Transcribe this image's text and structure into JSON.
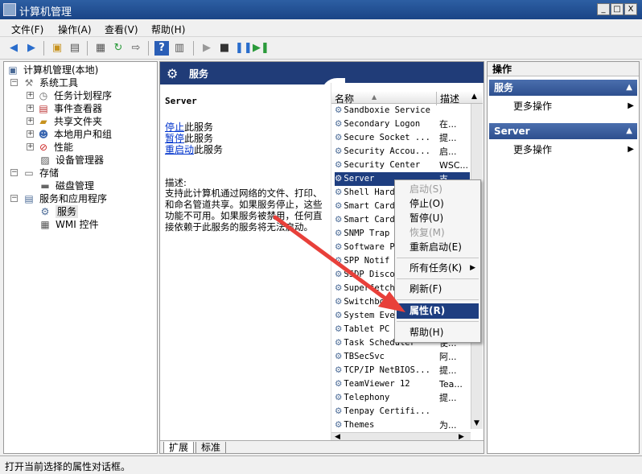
{
  "window": {
    "title": "计算机管理",
    "min": "_",
    "max": "□",
    "close": "X"
  },
  "menu": [
    "文件(F)",
    "操作(A)",
    "查看(V)",
    "帮助(H)"
  ],
  "tree": {
    "root": "计算机管理(本地)",
    "system_tools": "系统工具",
    "task_scheduler": "任务计划程序",
    "event_viewer": "事件查看器",
    "shared_folders": "共享文件夹",
    "local_users": "本地用户和组",
    "performance": "性能",
    "device_manager": "设备管理器",
    "storage": "存储",
    "disk_mgmt": "磁盘管理",
    "services_apps": "服务和应用程序",
    "services": "服务",
    "wmi": "WMI 控件"
  },
  "center": {
    "header": "服务",
    "service_name": "Server",
    "stop_link": "停止",
    "stop_suffix": "此服务",
    "pause_link": "暂停",
    "pause_suffix": "此服务",
    "restart_link": "重启动",
    "restart_suffix": "此服务",
    "desc_label": "描述:",
    "desc_text": "支持此计算机通过网络的文件、打印、和命名管道共享。如果服务停止，这些功能不可用。如果服务被禁用，任何直接依赖于此服务的服务将无法启动。",
    "col_name": "名称",
    "col_desc": "描述",
    "tab_extended": "扩展",
    "tab_standard": "标准"
  },
  "services": [
    {
      "name": "Sandboxie Service",
      "desc": ""
    },
    {
      "name": "Secondary Logon",
      "desc": "在..."
    },
    {
      "name": "Secure Socket ...",
      "desc": "提..."
    },
    {
      "name": "Security Accou...",
      "desc": "启..."
    },
    {
      "name": "Security Center",
      "desc": "WSC..."
    },
    {
      "name": "Server",
      "desc": "支..."
    },
    {
      "name": "Shell Hard",
      "desc": ""
    },
    {
      "name": "Smart Card",
      "desc": ""
    },
    {
      "name": "Smart Card",
      "desc": ""
    },
    {
      "name": "SNMP Trap",
      "desc": ""
    },
    {
      "name": "Software P",
      "desc": ""
    },
    {
      "name": "SPP Notif",
      "desc": ""
    },
    {
      "name": "SSDP Disco",
      "desc": ""
    },
    {
      "name": "Superfetch",
      "desc": ""
    },
    {
      "name": "Switchboard",
      "desc": ""
    },
    {
      "name": "System Eve",
      "desc": ""
    },
    {
      "name": "Tablet PC",
      "desc": ""
    },
    {
      "name": "Task Scheduler",
      "desc": "使..."
    },
    {
      "name": "TBSecSvc",
      "desc": "阿..."
    },
    {
      "name": "TCP/IP NetBIOS...",
      "desc": "提..."
    },
    {
      "name": "TeamViewer 12",
      "desc": "Tea..."
    },
    {
      "name": "Telephony",
      "desc": "提..."
    },
    {
      "name": "Tenpay Certifi...",
      "desc": ""
    },
    {
      "name": "Themes",
      "desc": "为..."
    }
  ],
  "context_menu": {
    "start": "启动(S)",
    "stop": "停止(O)",
    "pause": "暂停(U)",
    "resume": "恢复(M)",
    "restart": "重新启动(E)",
    "all_tasks": "所有任务(K)",
    "refresh": "刷新(F)",
    "properties": "属性(R)",
    "help": "帮助(H)"
  },
  "actions": {
    "header": "操作",
    "section1": "服务",
    "more1": "更多操作",
    "section2": "Server",
    "more2": "更多操作"
  },
  "status": "打开当前选择的属性对话框。",
  "colors": {
    "title_bar": "#1a4486",
    "selection": "#1e3e80",
    "arrow": "#e8403a"
  }
}
